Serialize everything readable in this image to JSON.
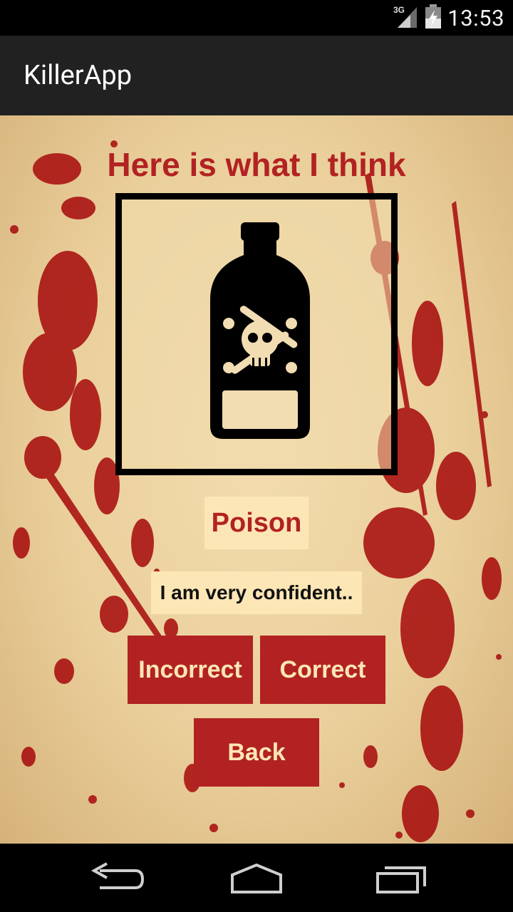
{
  "status_bar": {
    "network": "3G",
    "time": "13:53"
  },
  "app": {
    "title": "KillerApp"
  },
  "main": {
    "headline": "Here is what I think",
    "image_icon": "poison-bottle-icon",
    "result": "Poison",
    "confidence": "I am very confident..",
    "buttons": {
      "incorrect": "Incorrect",
      "correct": "Correct",
      "back": "Back"
    }
  },
  "colors": {
    "accent": "#b22222",
    "label_bg": "#fde6b5",
    "action_bar": "#212121"
  },
  "nav": {
    "back_icon": "back-arrow-icon",
    "home_icon": "home-icon",
    "recents_icon": "recents-icon"
  }
}
